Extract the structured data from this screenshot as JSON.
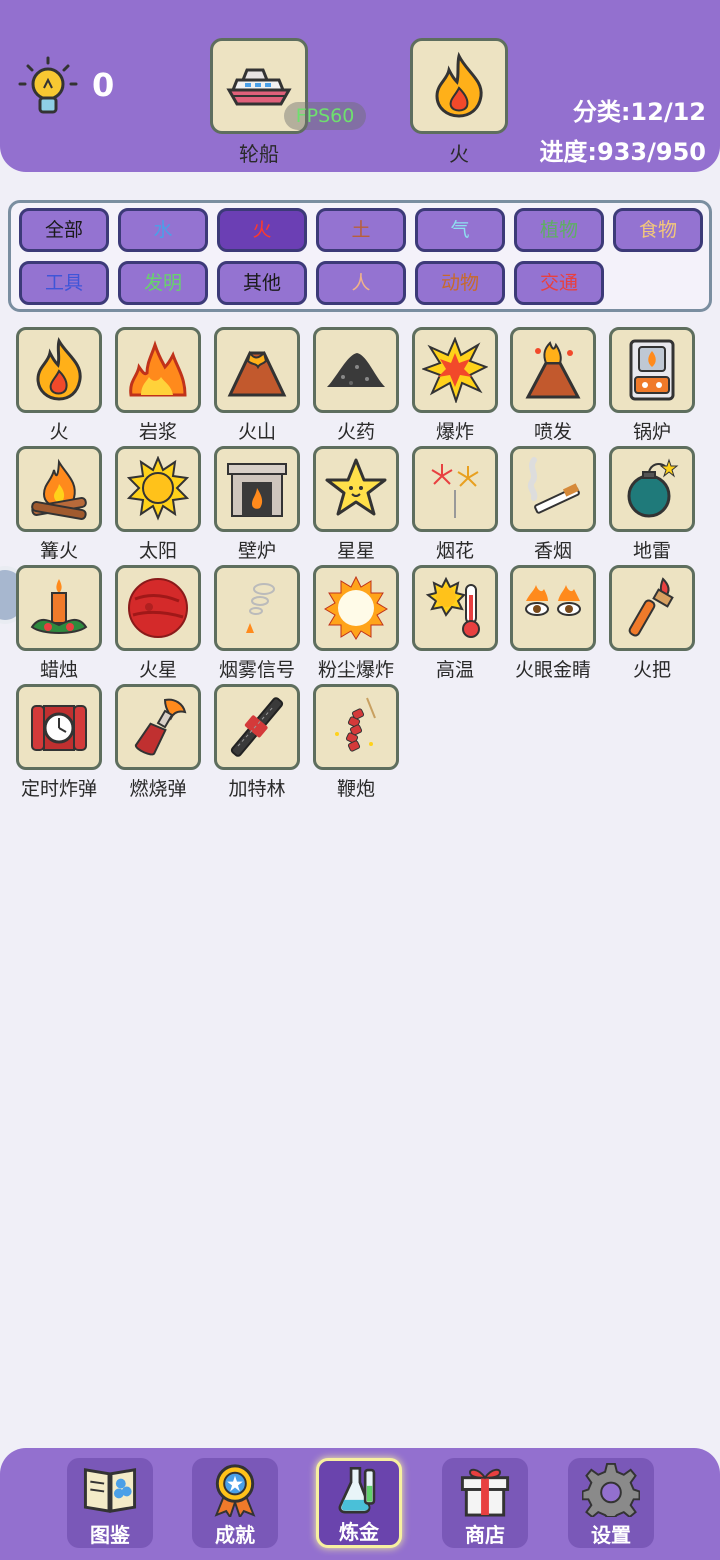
{
  "header": {
    "hint_count": "0",
    "slot_left": {
      "label": "轮船",
      "icon": "ship-icon"
    },
    "slot_right": {
      "label": "火",
      "icon": "fire-icon"
    },
    "fps": "FPS60",
    "category": "分类:12/12",
    "progress": "进度:933/950"
  },
  "categories": [
    {
      "label": "全部",
      "color": "#1a1a1a"
    },
    {
      "label": "水",
      "color": "#4aa0e8"
    },
    {
      "label": "火",
      "color": "#ff3a2a"
    },
    {
      "label": "土",
      "color": "#b8603a"
    },
    {
      "label": "气",
      "color": "#8ee0f0"
    },
    {
      "label": "植物",
      "color": "#5fae64"
    },
    {
      "label": "食物",
      "color": "#f3c77a"
    },
    {
      "label": "工具",
      "color": "#3f55d8"
    },
    {
      "label": "发明",
      "color": "#67d46a"
    },
    {
      "label": "其他",
      "color": "#1a1a1a"
    },
    {
      "label": "人",
      "color": "#f0b28a"
    },
    {
      "label": "动物",
      "color": "#c86a2a"
    },
    {
      "label": "交通",
      "color": "#e84040"
    }
  ],
  "active_category": "火",
  "elements": [
    {
      "label": "火",
      "icon": "fire-icon"
    },
    {
      "label": "岩浆",
      "icon": "magma-icon"
    },
    {
      "label": "火山",
      "icon": "volcano-icon"
    },
    {
      "label": "火药",
      "icon": "gunpowder-icon"
    },
    {
      "label": "爆炸",
      "icon": "explosion-icon"
    },
    {
      "label": "喷发",
      "icon": "eruption-icon"
    },
    {
      "label": "锅炉",
      "icon": "boiler-icon"
    },
    {
      "label": "篝火",
      "icon": "campfire-icon"
    },
    {
      "label": "太阳",
      "icon": "sun-icon"
    },
    {
      "label": "壁炉",
      "icon": "fireplace-icon"
    },
    {
      "label": "星星",
      "icon": "star-icon"
    },
    {
      "label": "烟花",
      "icon": "fireworks-icon"
    },
    {
      "label": "香烟",
      "icon": "cigarette-icon"
    },
    {
      "label": "地雷",
      "icon": "bomb-icon"
    },
    {
      "label": "蜡烛",
      "icon": "candle-icon"
    },
    {
      "label": "火星",
      "icon": "mars-icon"
    },
    {
      "label": "烟雾信号",
      "icon": "smoke-signal-icon"
    },
    {
      "label": "粉尘爆炸",
      "icon": "dust-explosion-icon"
    },
    {
      "label": "高温",
      "icon": "heat-icon"
    },
    {
      "label": "火眼金睛",
      "icon": "fire-eyes-icon"
    },
    {
      "label": "火把",
      "icon": "torch-icon"
    },
    {
      "label": "定时炸弹",
      "icon": "time-bomb-icon"
    },
    {
      "label": "燃烧弹",
      "icon": "molotov-icon"
    },
    {
      "label": "加特林",
      "icon": "gatling-icon"
    },
    {
      "label": "鞭炮",
      "icon": "firecracker-icon"
    }
  ],
  "nav": [
    {
      "label": "图鉴",
      "icon": "book-icon"
    },
    {
      "label": "成就",
      "icon": "medal-icon"
    },
    {
      "label": "炼金",
      "icon": "flask-icon"
    },
    {
      "label": "商店",
      "icon": "gift-icon"
    },
    {
      "label": "设置",
      "icon": "gear-icon"
    }
  ],
  "active_nav": "炼金"
}
